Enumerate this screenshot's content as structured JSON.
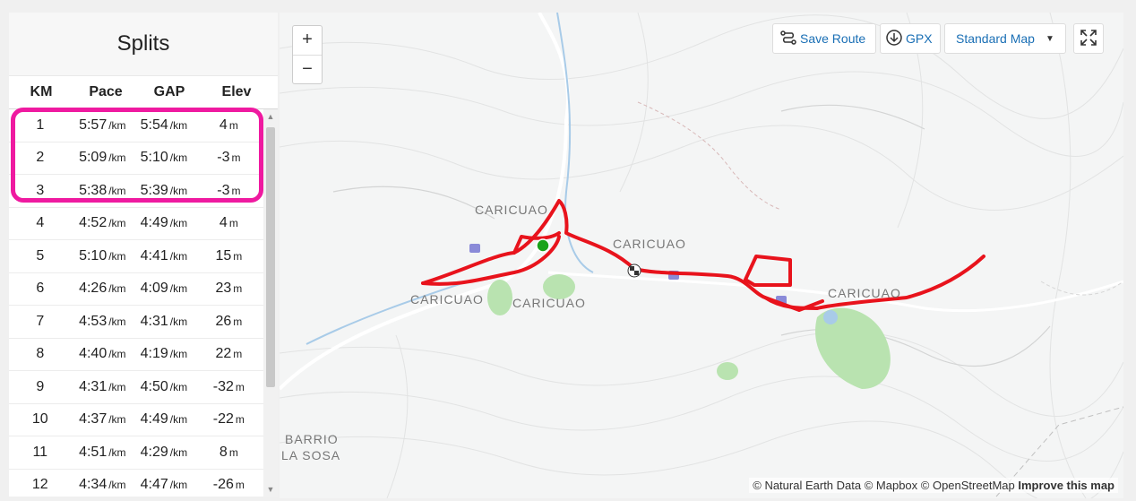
{
  "splits": {
    "title": "Splits",
    "columns": [
      "KM",
      "Pace",
      "GAP",
      "Elev"
    ],
    "pace_unit": "/km",
    "elev_unit": "m",
    "rows": [
      {
        "km": "1",
        "pace": "5:57",
        "gap": "5:54",
        "elev": "4"
      },
      {
        "km": "2",
        "pace": "5:09",
        "gap": "5:10",
        "elev": "-3"
      },
      {
        "km": "3",
        "pace": "5:38",
        "gap": "5:39",
        "elev": "-3"
      },
      {
        "km": "4",
        "pace": "4:52",
        "gap": "4:49",
        "elev": "4"
      },
      {
        "km": "5",
        "pace": "5:10",
        "gap": "4:41",
        "elev": "15"
      },
      {
        "km": "6",
        "pace": "4:26",
        "gap": "4:09",
        "elev": "23"
      },
      {
        "km": "7",
        "pace": "4:53",
        "gap": "4:31",
        "elev": "26"
      },
      {
        "km": "8",
        "pace": "4:40",
        "gap": "4:19",
        "elev": "22"
      },
      {
        "km": "9",
        "pace": "4:31",
        "gap": "4:50",
        "elev": "-32"
      },
      {
        "km": "10",
        "pace": "4:37",
        "gap": "4:49",
        "elev": "-22"
      },
      {
        "km": "11",
        "pace": "4:51",
        "gap": "4:29",
        "elev": "8"
      },
      {
        "km": "12",
        "pace": "4:34",
        "gap": "4:47",
        "elev": "-26"
      }
    ],
    "highlight_color": "#ef1aa0"
  },
  "map": {
    "zoom_in": "+",
    "zoom_out": "−",
    "save_route": "Save Route",
    "gpx": "GPX",
    "map_style": "Standard Map",
    "labels": [
      "CARICUAO",
      "CARICUAO",
      "CARICUAO",
      "CARICUAO",
      "CARICUAO",
      "BARRIO",
      "LA SOSA"
    ],
    "attribution": "© Natural Earth Data © Mapbox © OpenStreetMap",
    "improve": "Improve this map",
    "route_color": "#e8131c",
    "start_color": "#1aa31a",
    "park_color": "#b9e3b0",
    "water_color": "#a8cbe8"
  }
}
